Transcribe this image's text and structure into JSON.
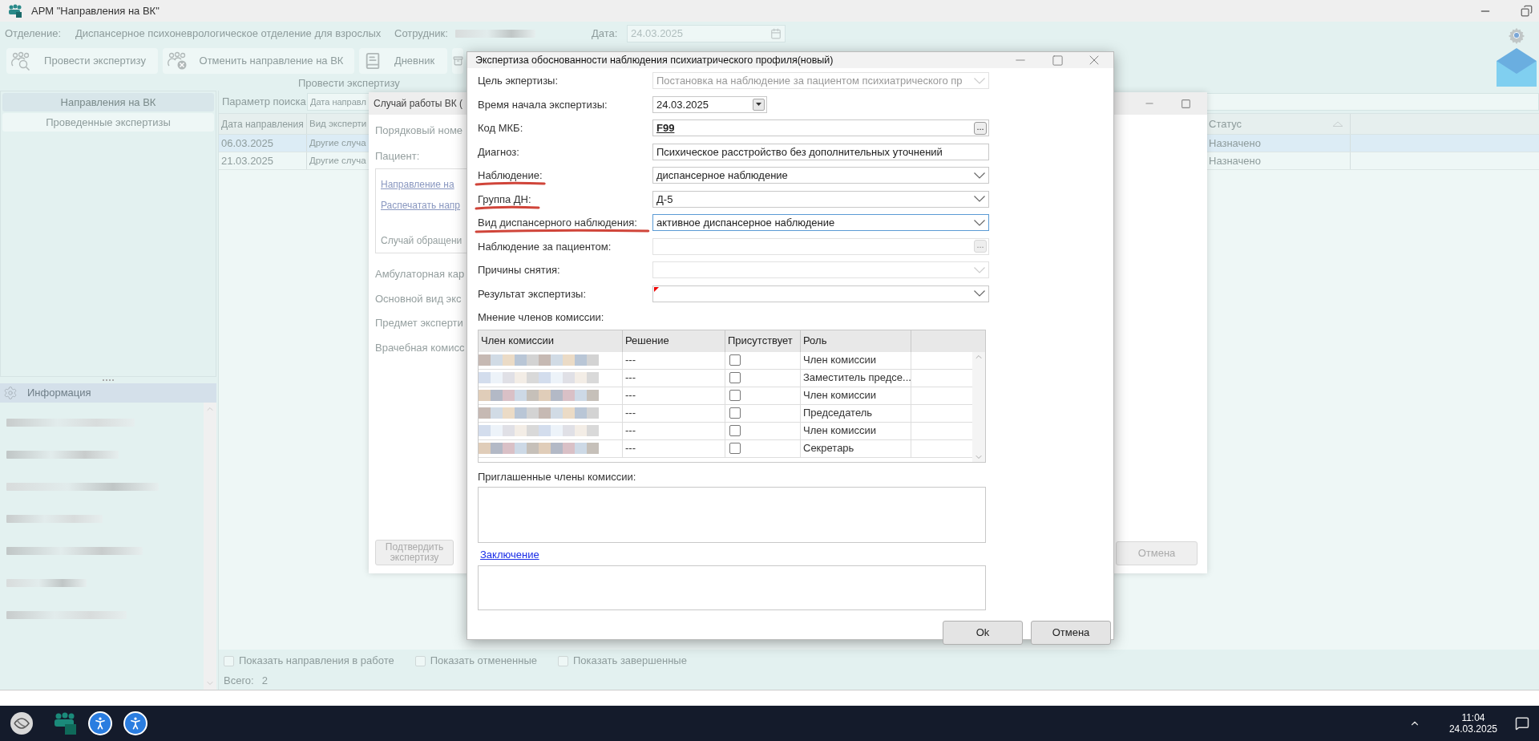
{
  "app": {
    "title": "АРМ \"Направления на ВК\""
  },
  "header": {
    "department_label": "Отделение:",
    "department": "Диспансерное психоневрологическое отделение для взрослых",
    "employee_label": "Сотрудник:",
    "date_label": "Дата:",
    "date": "24.03.2025"
  },
  "toolbar": {
    "buttons": [
      {
        "kind": "examine",
        "label": "Провести экспертизу"
      },
      {
        "kind": "cancel",
        "label": "Отменить направление на ВК"
      },
      {
        "kind": "diary",
        "label": "Дневник"
      },
      {
        "kind": "archive"
      }
    ],
    "group_caption": "Провести экспертизу"
  },
  "left_panel": {
    "tabs": [
      {
        "label": "Направления на ВК",
        "selected": true
      },
      {
        "label": "Проведенные экспертизы",
        "selected": false
      }
    ]
  },
  "info_panel": {
    "title": "Информация"
  },
  "main_table": {
    "search_label": "Параметр поиска",
    "search_field": "Дата направл",
    "columns": [
      "Дата направления",
      "Вид эксперти",
      "Статус"
    ],
    "rows": [
      {
        "date": "06.03.2025",
        "type": "Другие случа",
        "status": "Назначено",
        "selected": true
      },
      {
        "date": "21.03.2025",
        "type": "Другие случа",
        "status": "Назначено",
        "selected": false
      }
    ]
  },
  "filters": [
    {
      "label": "Показать направления в работе",
      "checked": false
    },
    {
      "label": "Показать отмененные",
      "checked": false
    },
    {
      "label": "Показать завершенные",
      "checked": false
    }
  ],
  "total_label": "Всего:",
  "total": "2",
  "case_window": {
    "title": "Случай работы ВК (",
    "labels_top": [
      "Порядковый номе",
      "Пациент:"
    ],
    "links": [
      "Направление на",
      "Распечатать напр"
    ],
    "box_label": "Случай обращени",
    "labels_bottom": [
      "Амбулаторная кар",
      "Основной вид экс",
      "Предмет эксперти",
      "Врачебная комисс"
    ],
    "confirm_button": "Подтвердить экспертизу",
    "cancel_button": "Отмена"
  },
  "dialog": {
    "title": "Экспертиза обоснованности наблюдения психиатрического профиля(новый)",
    "fields": [
      {
        "kind": "combo",
        "label": "Цель экпертизы:",
        "value": "Постановка на наблюдение за пациентом психиатрического пр",
        "disabled": true,
        "underlined": false,
        "focused": false,
        "required": false
      },
      {
        "kind": "date",
        "label": "Время начала экспертизы:",
        "value": "24.03.2025",
        "disabled": false,
        "underlined": false,
        "focused": false,
        "required": false
      },
      {
        "kind": "lookup",
        "label": "Код МКБ:",
        "value": "F99",
        "button_text": "...",
        "disabled": false,
        "underlined": false,
        "focused": false,
        "required": false
      },
      {
        "kind": "text",
        "label": "Диагноз:",
        "value": "Психическое расстройство без дополнительных уточнений",
        "disabled": false,
        "underlined": false,
        "focused": false,
        "required": false
      },
      {
        "kind": "combo",
        "label": "Наблюдение:",
        "value": "диспансерное наблюдение",
        "disabled": false,
        "underlined": true,
        "focused": false,
        "required": false
      },
      {
        "kind": "combo",
        "label": "Группа ДН:",
        "value": "Д-5",
        "disabled": false,
        "underlined": true,
        "focused": false,
        "required": false
      },
      {
        "kind": "combo",
        "label": "Вид диспансерного наблюдения:",
        "value": "активное диспансерное наблюдение",
        "disabled": false,
        "underlined": true,
        "focused": true,
        "required": false
      },
      {
        "kind": "lookup",
        "label": "Наблюдение за пациентом:",
        "button_text": "...",
        "disabled": true,
        "underlined": false,
        "focused": false,
        "required": false
      },
      {
        "kind": "combo",
        "label": "Причины снятия:",
        "disabled": true,
        "underlined": false,
        "focused": false,
        "required": false
      },
      {
        "kind": "combo",
        "label": "Результат экспертизы:",
        "disabled": false,
        "underlined": false,
        "focused": false,
        "required": true
      }
    ],
    "opinions_label": "Мнение членов комиссии:",
    "members_table": {
      "columns": [
        "Член комиссии",
        "Решение",
        "Присутствует",
        "Роль"
      ],
      "rows": [
        {
          "decision": "---",
          "present": false,
          "role": "Член комиссии"
        },
        {
          "decision": "---",
          "present": false,
          "role": "Заместитель предсе..."
        },
        {
          "decision": "---",
          "present": false,
          "role": "Член комиссии"
        },
        {
          "decision": "---",
          "present": false,
          "role": "Председатель"
        },
        {
          "decision": "---",
          "present": false,
          "role": "Член комиссии"
        },
        {
          "decision": "---",
          "present": false,
          "role": "Секретарь"
        }
      ]
    },
    "invited_label": "Приглашенные члены комиссии:",
    "conclusion_link": "Заключение",
    "buttons": [
      "Ok",
      "Отмена"
    ]
  },
  "taskbar": {
    "time": "11:04",
    "date": "24.03.2025"
  }
}
